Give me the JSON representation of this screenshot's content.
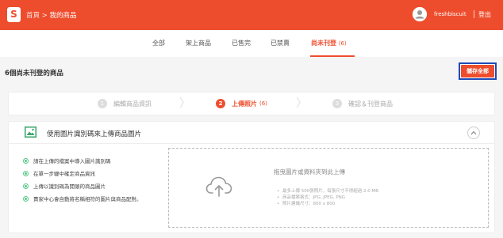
{
  "header": {
    "logo_glyph": "S",
    "breadcrumb_home": "首頁",
    "breadcrumb_sep": ">",
    "breadcrumb_current": "我的商品",
    "username": "freshbiscuit",
    "logout_label": "登出",
    "brand_color": "#ee4d2d"
  },
  "tabs": [
    {
      "label": "全部",
      "count": "",
      "active": false
    },
    {
      "label": "架上商品",
      "count": "",
      "active": false
    },
    {
      "label": "已售完",
      "count": "",
      "active": false
    },
    {
      "label": "已禁賣",
      "count": "",
      "active": false
    },
    {
      "label": "尚未刊登",
      "count": "(6)",
      "active": true
    }
  ],
  "subheader": {
    "title": "6個尚未刊登的商品",
    "save_all_label": "儲存全部"
  },
  "stepper": {
    "steps": [
      {
        "num": "1",
        "label": "編輯商品資訊",
        "count": "",
        "active": false
      },
      {
        "num": "2",
        "label": "上傳照片",
        "count": "(6)",
        "active": true
      },
      {
        "num": "3",
        "label": "確認＆刊登商品",
        "count": "",
        "active": false
      }
    ],
    "chevron_glyph": "〉"
  },
  "upload": {
    "title": "使用圖片識別碼來上傳商品圖片",
    "tips": [
      "請在上傳的檔案中導入圖片識別碼",
      "在單一步驟中確定商品資訊",
      "上傳以識別碼為開頭的商品圖片",
      "賣家中心會自動將名稱相符的圖片與商品配對。"
    ],
    "dropzone_title": "拖曳圖片或資料夾到此上傳",
    "rules": [
      "最多上傳 500張照片，每張尺寸不得超過 2.0 MB",
      "商品檔案格式：JPG, JPEG, PNG",
      "照片建議尺寸：800 x 800"
    ],
    "icons": {
      "panel": "image-icon",
      "collapse": "chevron-up-icon",
      "dropzone": "cloud-upload-icon",
      "tip": "check-circle-icon"
    },
    "tip_color": "#57c788"
  }
}
